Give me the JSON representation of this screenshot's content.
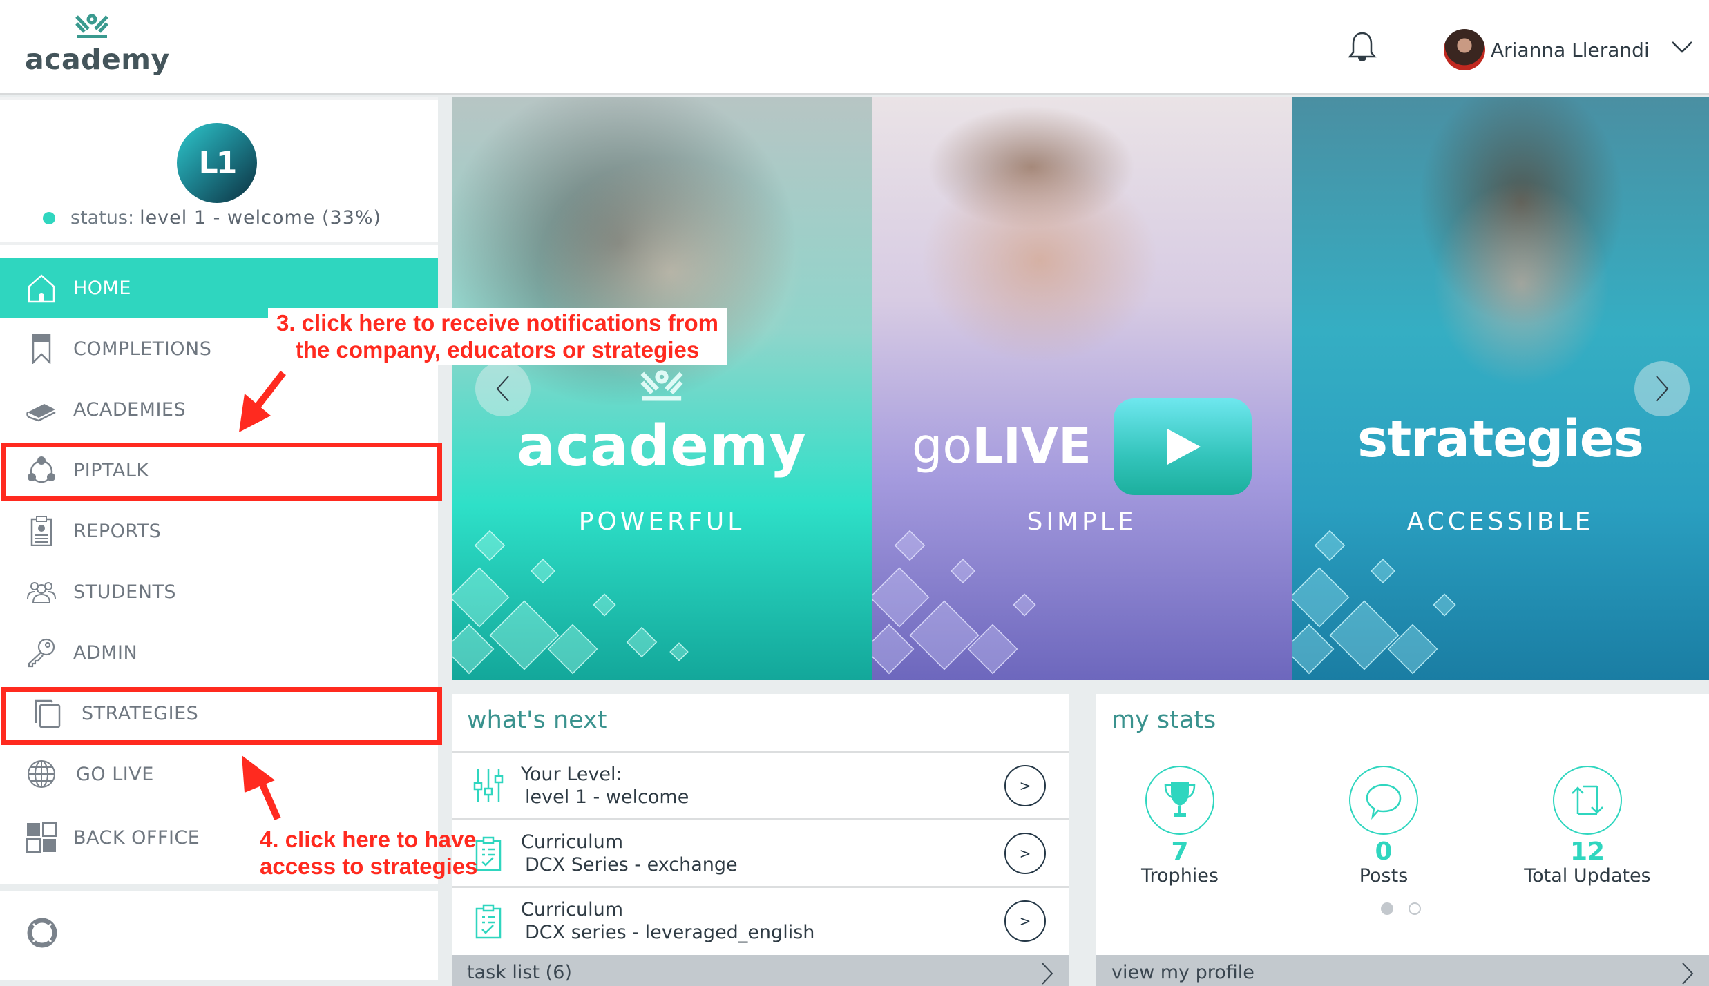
{
  "header": {
    "brand": "academy",
    "user_name": "Arianna Llerandi"
  },
  "sidebar": {
    "level_badge": "L1",
    "status_label": "status:",
    "status_value": "level 1 - welcome (33%)",
    "items": [
      {
        "label": "HOME",
        "icon": "home-icon",
        "active": true
      },
      {
        "label": "COMPLETIONS",
        "icon": "bookmark-icon"
      },
      {
        "label": "ACADEMIES",
        "icon": "book-icon"
      },
      {
        "label": "PIPTALK",
        "icon": "network-icon"
      },
      {
        "label": "REPORTS",
        "icon": "clipboard-report-icon"
      },
      {
        "label": "STUDENTS",
        "icon": "users-icon"
      },
      {
        "label": "ADMIN",
        "icon": "key-icon"
      },
      {
        "label": "STRATEGIES",
        "icon": "copy-icon"
      },
      {
        "label": "GO LIVE",
        "icon": "globe-icon"
      },
      {
        "label": "BACK OFFICE",
        "icon": "grid-icon"
      }
    ]
  },
  "annotations": {
    "note3": "3. click here to receive notifications from the company, educators or strategies",
    "note3_line1": "3. click here to receive notifications from",
    "note3_line2": "the company, educators or strategies",
    "note4_line1": "4. click here to have",
    "note4_line2": "access to strategies"
  },
  "carousel": {
    "slides": [
      {
        "title": "academy",
        "subtitle": "POWERFUL"
      },
      {
        "title_light": "go",
        "title_bold": "LIVE",
        "subtitle": "SIMPLE"
      },
      {
        "title": "strategies",
        "subtitle": "ACCESSIBLE"
      }
    ]
  },
  "whats_next": {
    "title": "what's next",
    "rows": [
      {
        "line1": "Your Level:",
        "line2": "level 1 - welcome",
        "icon": "sliders-icon",
        "action": ">"
      },
      {
        "line1": "Curriculum",
        "line2": "DCX Series - exchange",
        "icon": "clipboard-check-icon",
        "action": ">"
      },
      {
        "line1": "Curriculum",
        "line2": "DCX series - leveraged_english",
        "icon": "clipboard-check-icon",
        "action": ">"
      }
    ],
    "footer": "task list (6)"
  },
  "my_stats": {
    "title": "my stats",
    "stats": [
      {
        "value": "7",
        "label": "Trophies",
        "icon": "trophy-icon"
      },
      {
        "value": "0",
        "label": "Posts",
        "icon": "chat-bubble-icon"
      },
      {
        "value": "12",
        "label": "Total Updates",
        "icon": "repost-icon"
      }
    ],
    "page_indicator": {
      "current": 1,
      "total": 2
    },
    "footer": "view my profile"
  },
  "colors": {
    "accent": "#2fd6bf",
    "title_teal": "#3a928e",
    "annotation_red": "#ff2a1f",
    "footer_gray": "#c3c9ce"
  }
}
